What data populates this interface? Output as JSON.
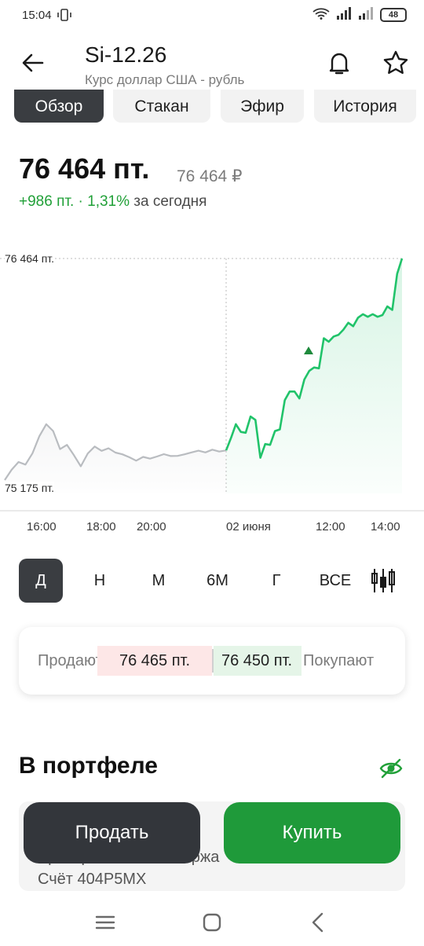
{
  "status": {
    "time": "15:04",
    "battery": "48"
  },
  "header": {
    "title": "Si-12.26",
    "subtitle": "Курс доллар США - рубль"
  },
  "tabs": [
    {
      "label": "Обзор"
    },
    {
      "label": "Стакан"
    },
    {
      "label": "Эфир"
    },
    {
      "label": "История"
    }
  ],
  "price": {
    "main": "76 464 пт.",
    "alt": "76 464 ₽",
    "change": "+986 пт. · 1,31%",
    "change_suffix": "за сегодня"
  },
  "chart_data": {
    "type": "line",
    "max_label": "76 464 пт.",
    "min_label": "75 175 пт.",
    "ylim": [
      75175,
      76464
    ],
    "x_ticks": [
      "16:00",
      "18:00",
      "20:00",
      "02 июня",
      "12:00",
      "14:00"
    ],
    "series": [
      {
        "segment": "previous day",
        "color": "#b9bcc0",
        "points": [
          75175,
          75235,
          75280,
          75265,
          75330,
          75430,
          75500,
          75460,
          75355,
          75380,
          75320,
          75255,
          75330,
          75370,
          75345,
          75360,
          75335,
          75325,
          75308,
          75288,
          75310,
          75300,
          75312,
          75326,
          75315,
          75316,
          75325,
          75336,
          75346,
          75336,
          75352,
          75341,
          75348
        ]
      },
      {
        "segment": "today",
        "color": "#21c36a",
        "points": [
          75348,
          75420,
          75500,
          75455,
          75450,
          75545,
          75525,
          75305,
          75385,
          75380,
          75460,
          75470,
          75640,
          75690,
          75690,
          75650,
          75760,
          75810,
          75830,
          75825,
          76000,
          75980,
          76010,
          76020,
          76050,
          76090,
          76070,
          76120,
          76140,
          76125,
          76140,
          76125,
          76135,
          76185,
          76165,
          76375,
          76464
        ]
      }
    ]
  },
  "periods": [
    {
      "label": "Д"
    },
    {
      "label": "Н"
    },
    {
      "label": "М"
    },
    {
      "label": "6М"
    },
    {
      "label": "Г"
    },
    {
      "label": "ВСЕ"
    }
  ],
  "orderbook": {
    "sell_label": "Продают",
    "sell_price": "76 465 пт.",
    "buy_price": "76 450 пт.",
    "buy_label": "Покупают"
  },
  "portfolio": {
    "title": "В портфеле",
    "account_name": "Брокерский счёт · Биржа",
    "account_number": "Счёт 404P5MX"
  },
  "actions": {
    "sell": "Продать",
    "buy": "Купить"
  },
  "colors": {
    "green": "#21a038",
    "chart_green": "#21c36a",
    "dark": "#3a3d41"
  }
}
